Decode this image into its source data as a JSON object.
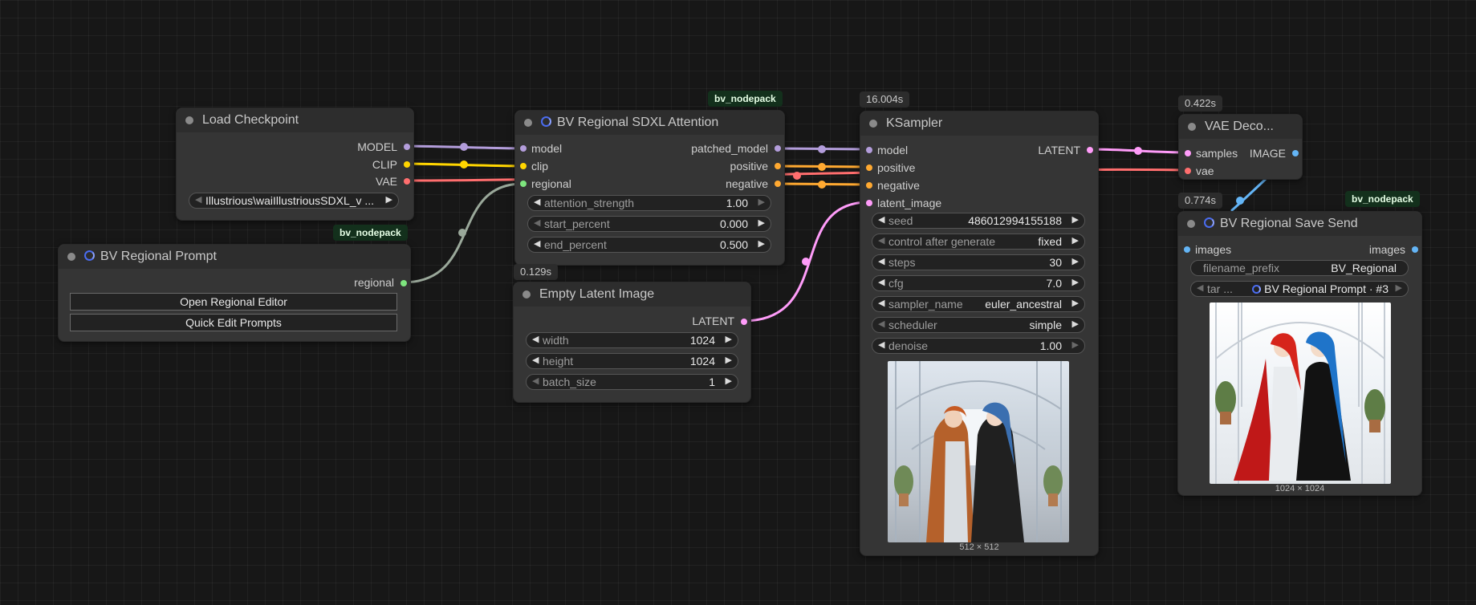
{
  "colors": {
    "model": "#b39ddb",
    "clip": "#ffd500",
    "vae": "#ff6e6e",
    "regional": "#7ee57e",
    "conditioning": "#ffa931",
    "latent": "#ff9cf9",
    "image": "#64b5f6",
    "wire_regional": "#9aa89a"
  },
  "load_checkpoint": {
    "title": "Load Checkpoint",
    "outputs": [
      "MODEL",
      "CLIP",
      "VAE"
    ],
    "ckpt_name": "Illustrious\\waiIllustriousSDXL_v ..."
  },
  "bv_prompt": {
    "badge": "bv_nodepack",
    "title": "BV Regional Prompt",
    "output": "regional",
    "buttons": [
      "Open Regional Editor",
      "Quick Edit Prompts"
    ]
  },
  "bv_attention": {
    "badge": "bv_nodepack",
    "title": "BV Regional SDXL Attention",
    "inputs": [
      "model",
      "clip",
      "regional"
    ],
    "outputs": [
      "patched_model",
      "positive",
      "negative"
    ],
    "widgets": [
      {
        "label": "attention_strength",
        "value": "1.00"
      },
      {
        "label": "start_percent",
        "value": "0.000"
      },
      {
        "label": "end_percent",
        "value": "0.500"
      }
    ]
  },
  "empty_latent": {
    "time": "0.129s",
    "title": "Empty Latent Image",
    "output": "LATENT",
    "widgets": [
      {
        "label": "width",
        "value": "1024"
      },
      {
        "label": "height",
        "value": "1024"
      },
      {
        "label": "batch_size",
        "value": "1"
      }
    ]
  },
  "ksampler": {
    "time": "16.004s",
    "title": "KSampler",
    "inputs": [
      "model",
      "positive",
      "negative",
      "latent_image"
    ],
    "output": "LATENT",
    "widgets": [
      {
        "label": "seed",
        "value": "486012994155188"
      },
      {
        "label": "control after generate",
        "value": "fixed"
      },
      {
        "label": "steps",
        "value": "30"
      },
      {
        "label": "cfg",
        "value": "7.0"
      },
      {
        "label": "sampler_name",
        "value": "euler_ancestral"
      },
      {
        "label": "scheduler",
        "value": "simple"
      },
      {
        "label": "denoise",
        "value": "1.00"
      }
    ],
    "preview_caption": "512 × 512"
  },
  "vae_decode": {
    "time": "0.422s",
    "title": "VAE Deco...",
    "inputs": [
      "samples",
      "vae"
    ],
    "output": "IMAGE"
  },
  "save_send": {
    "time": "0.774s",
    "badge": "bv_nodepack",
    "title": "BV Regional Save Send",
    "input": "images",
    "output": "images",
    "widgets": [
      {
        "label": "filename_prefix",
        "value": "BV_Regional"
      },
      {
        "label": "tar ...",
        "value": "BV Regional Prompt · #3"
      }
    ],
    "preview_caption": "1024 × 1024"
  }
}
